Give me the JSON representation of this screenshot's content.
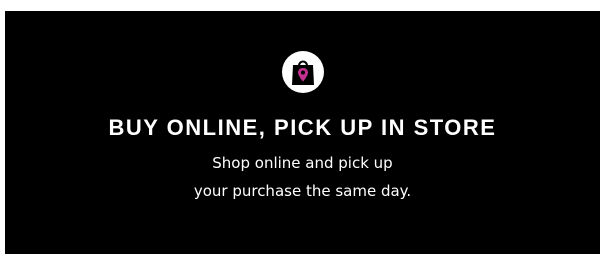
{
  "banner": {
    "icon": "shopping-bag-location-pin-icon",
    "accent_color": "#c2318e",
    "heading": "BUY ONLINE, PICK UP IN STORE",
    "subtext_line1": "Shop online and pick up",
    "subtext_line2": "your purchase the same day."
  }
}
